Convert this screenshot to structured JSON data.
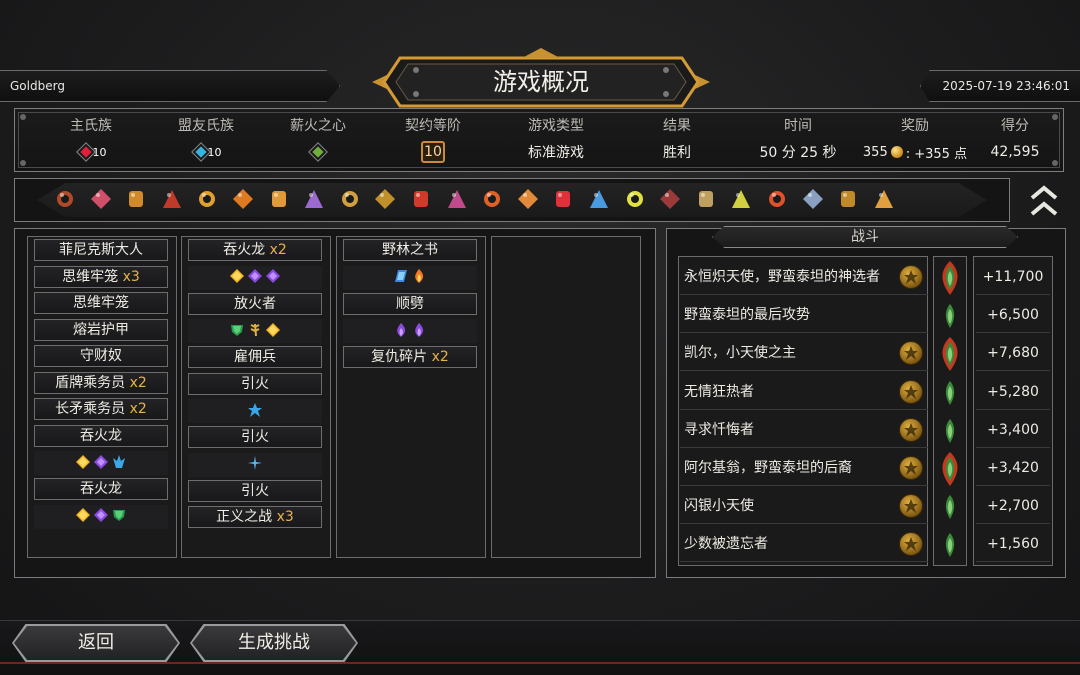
{
  "header": {
    "player_name": "Goldberg",
    "datetime": "2025-07-19 23:46:01",
    "title": "游戏概况"
  },
  "stats": {
    "main_clan": {
      "label": "主氏族",
      "level": "10",
      "color": "#e0203a"
    },
    "ally_clan": {
      "label": "盟友氏族",
      "level": "10",
      "color": "#36b4e0"
    },
    "pyre_heart": {
      "label": "薪火之心",
      "color": "#6fae3a"
    },
    "covenant": {
      "label": "契约等阶",
      "value": "10"
    },
    "game_type": {
      "label": "游戏类型",
      "value": "标准游戏"
    },
    "result": {
      "label": "结果",
      "value": "胜利"
    },
    "time": {
      "label": "时间",
      "value": "50 分 25 秒"
    },
    "reward": {
      "label": "奖励",
      "value_prefix": "355",
      "value_suffix": ": +355 点"
    },
    "score": {
      "label": "得分",
      "value": "42,595"
    }
  },
  "relics": [
    {
      "icon": "skull-relic-icon",
      "color": "#b04a2a"
    },
    {
      "icon": "maw-relic-icon",
      "color": "#d0506a"
    },
    {
      "icon": "urn-relic-icon",
      "color": "#d08a2a"
    },
    {
      "icon": "claw-relic-icon",
      "color": "#c03a2a"
    },
    {
      "icon": "lantern-relic-icon",
      "color": "#e0a030"
    },
    {
      "icon": "tablet-relic-icon",
      "color": "#e07a20"
    },
    {
      "icon": "sun-relic-icon",
      "color": "#e09a3a"
    },
    {
      "icon": "staff-relic-icon",
      "color": "#9a6ad0"
    },
    {
      "icon": "wings-relic-icon",
      "color": "#d0a040"
    },
    {
      "icon": "blades-relic-icon",
      "color": "#c0902a"
    },
    {
      "icon": "demon-relic-icon",
      "color": "#d03a2a"
    },
    {
      "icon": "wand-relic-icon",
      "color": "#c04a8a"
    },
    {
      "icon": "mask-relic-icon",
      "color": "#e0602a"
    },
    {
      "icon": "scroll-relic-icon",
      "color": "#e08a3a"
    },
    {
      "icon": "burst-relic-icon",
      "color": "#e0303a"
    },
    {
      "icon": "flask-relic-icon",
      "color": "#4a9ae0"
    },
    {
      "icon": "crystal-relic-icon",
      "color": "#e0e040"
    },
    {
      "icon": "bat-relic-icon",
      "color": "#9a3a3a"
    },
    {
      "icon": "spear-relic-icon",
      "color": "#c0a060"
    },
    {
      "icon": "larva-relic-icon",
      "color": "#d0d040"
    },
    {
      "icon": "ember-relic-icon",
      "color": "#e0502a"
    },
    {
      "icon": "fork-relic-icon",
      "color": "#8aa0c0"
    },
    {
      "icon": "tome-relic-icon",
      "color": "#c08a2a"
    },
    {
      "icon": "key-relic-icon",
      "color": "#e0a040"
    }
  ],
  "columns": [
    {
      "items": [
        {
          "name": "菲尼克斯大人",
          "count": ""
        },
        {
          "name": "思维牢笼",
          "count": "x3"
        },
        {
          "name": "思维牢笼",
          "count": ""
        },
        {
          "name": "熔岩护甲",
          "count": ""
        },
        {
          "name": "守财奴",
          "count": ""
        },
        {
          "name": "盾牌乘务员",
          "count": "x2"
        },
        {
          "name": "长矛乘务员",
          "count": "x2"
        },
        {
          "name": "吞火龙",
          "count": ""
        },
        {
          "gems": [
            "gold",
            "purple",
            "blue-flame"
          ]
        },
        {
          "name": "吞火龙",
          "count": ""
        },
        {
          "gems": [
            "gold",
            "purple",
            "green"
          ]
        }
      ]
    },
    {
      "items": [
        {
          "name": "吞火龙",
          "count": "x2"
        },
        {
          "gems": [
            "gold",
            "purple",
            "purple"
          ]
        },
        {
          "name": "放火者",
          "count": ""
        },
        {
          "gems": [
            "green",
            "wheat",
            "gold"
          ]
        },
        {
          "name": "雇佣兵",
          "count": ""
        },
        {
          "name": "引火",
          "count": ""
        },
        {
          "gems": [
            "blue-star"
          ]
        },
        {
          "name": "引火",
          "count": ""
        },
        {
          "gems": [
            "blue-spark"
          ]
        },
        {
          "name": "引火",
          "count": ""
        },
        {
          "name": "正义之战",
          "count": "x3"
        }
      ]
    },
    {
      "items": [
        {
          "name": "野林之书",
          "count": ""
        },
        {
          "gems": [
            "blue-card",
            "orange-flame"
          ]
        },
        {
          "name": "顺劈",
          "count": ""
        },
        {
          "gems": [
            "purple-flame",
            "purple-flame"
          ]
        },
        {
          "name": "复仇碎片",
          "count": "x2"
        }
      ]
    },
    {
      "items": []
    }
  ],
  "battle": {
    "tab_label": "战斗",
    "rows": [
      {
        "name": "永恒炽天使，野蛮泰坦的神选者",
        "badge": "winged-badge-icon",
        "torch": "boss",
        "score": "+11,700"
      },
      {
        "name": "野蛮泰坦的最后攻势",
        "badge": "",
        "torch": "normal",
        "score": "+6,500"
      },
      {
        "name": "凯尔，小天使之主",
        "badge": "crown-badge-icon",
        "torch": "boss",
        "score": "+7,680"
      },
      {
        "name": "无情狂热者",
        "badge": "zealot-badge-icon",
        "torch": "normal",
        "score": "+5,280"
      },
      {
        "name": "寻求忏悔者",
        "badge": "penitent-badge-icon",
        "torch": "normal",
        "score": "+3,400"
      },
      {
        "name": "阿尔基翁，野蛮泰坦的后裔",
        "badge": "titan-badge-icon",
        "torch": "boss",
        "score": "+3,420"
      },
      {
        "name": "闪银小天使",
        "badge": "silver-badge-icon",
        "torch": "normal",
        "score": "+2,700"
      },
      {
        "name": "少数被遗忘者",
        "badge": "forgotten-badge-icon",
        "torch": "normal",
        "score": "+1,560"
      }
    ]
  },
  "buttons": {
    "back": "返回",
    "challenge": "生成挑战"
  }
}
